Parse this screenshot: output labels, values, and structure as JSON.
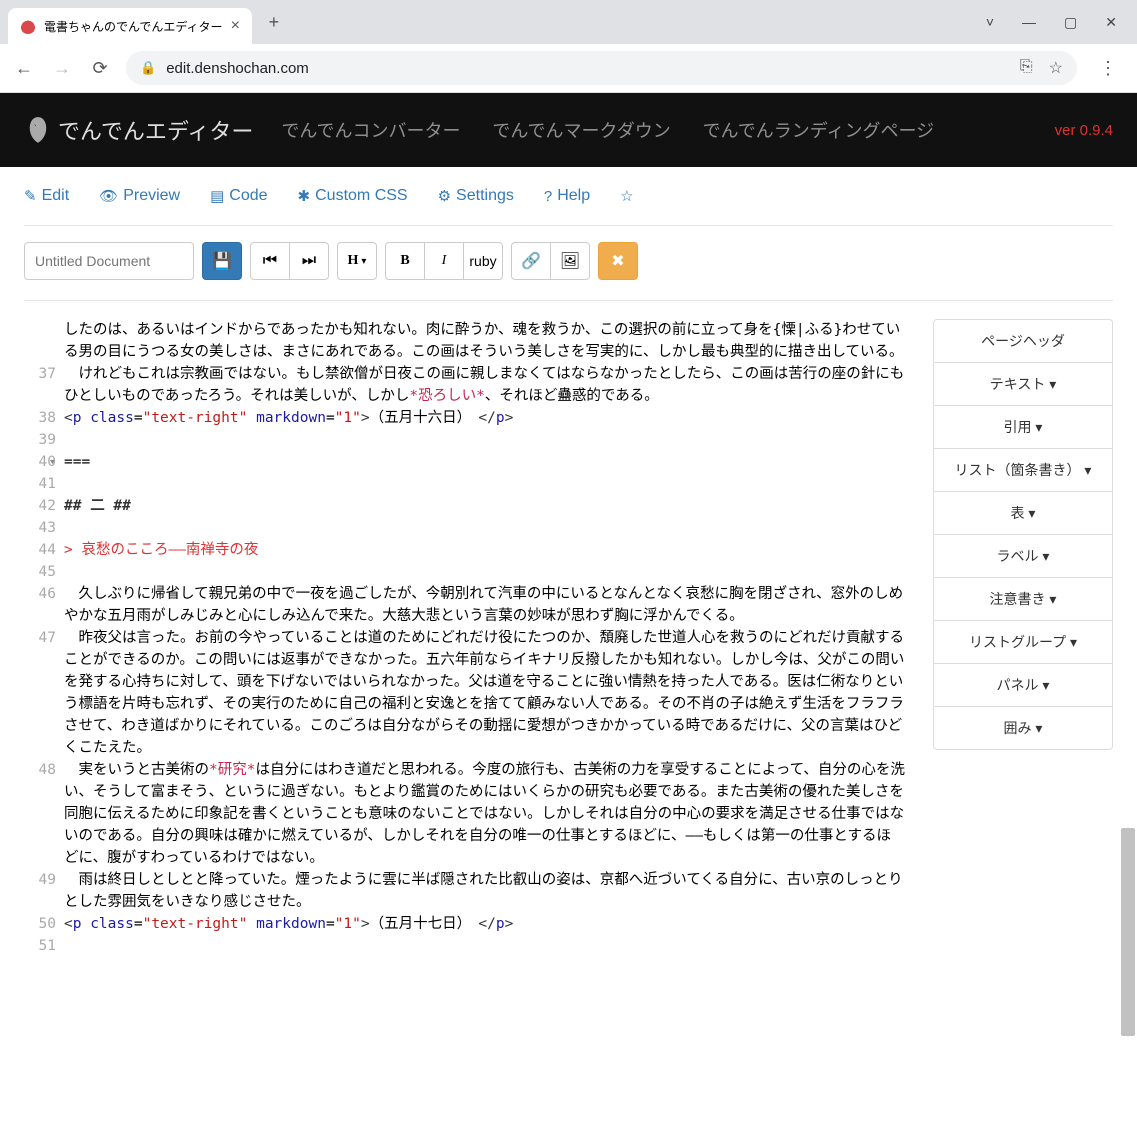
{
  "browser": {
    "tab_title": "電書ちゃんのでんでんエディター",
    "url": "edit.denshochan.com"
  },
  "header": {
    "brand": "でんでんエディター",
    "nav": [
      "でんでんコンバーター",
      "でんでんマークダウン",
      "でんでんランディングページ"
    ],
    "version": "ver 0.9.4"
  },
  "tabs": {
    "edit": "Edit",
    "preview": "Preview",
    "code": "Code",
    "css": "Custom CSS",
    "settings": "Settings",
    "help": "Help"
  },
  "title_placeholder": "Untitled Document",
  "btn_labels": {
    "heading": "H",
    "bold": "B",
    "italic": "I",
    "ruby": "ruby"
  },
  "sidebar": {
    "items": [
      "ページヘッダ",
      "テキスト ▾",
      "引用 ▾",
      "リスト（箇条書き） ▾",
      "表 ▾",
      "ラベル ▾",
      "注意書き ▾",
      "リストグループ ▾",
      "パネル ▾",
      "囲み ▾"
    ]
  },
  "editor": {
    "lines": [
      {
        "n": "",
        "text": "したのは、あるいはインドからであったかも知れない。肉に酔うか、魂を救うか、この選択の前に立って身を{慄|ふる}わせている男の目にうつる女の美しさは、まさにあれである。この画はそういう美しさを写実的に、しかし最も典型的に描き出している。"
      },
      {
        "n": "37",
        "text": "　けれどもこれは宗教画ではない。もし禁欲僧が日夜この画に親しまなくてはならなかったとしたら、この画は苦行の座の針にもひとしいものであったろう。それは美しいが、しかし",
        "em": "*恐ろしい*",
        "tail": "、それほど蠱惑的である。"
      },
      {
        "n": "38",
        "type": "ptag",
        "inner": "（五月十六日）　"
      },
      {
        "n": "39",
        "text": ""
      },
      {
        "n": "40",
        "fold": true,
        "text": "==="
      },
      {
        "n": "41",
        "text": ""
      },
      {
        "n": "42",
        "type": "head",
        "text": "## 二 ##"
      },
      {
        "n": "43",
        "text": ""
      },
      {
        "n": "44",
        "type": "quote",
        "text": "> 哀愁のこころ——南禅寺の夜"
      },
      {
        "n": "45",
        "text": ""
      },
      {
        "n": "46",
        "text": "　久しぶりに帰省して親兄弟の中で一夜を過ごしたが、今朝別れて汽車の中にいるとなんとなく哀愁に胸を閉ざされ、窓外のしめやかな五月雨がしみじみと心にしみ込んで来た。大慈大悲という言葉の妙味が思わず胸に浮かんでくる。"
      },
      {
        "n": "47",
        "text": "　昨夜父は言った。お前の今やっていることは道のためにどれだけ役にたつのか、頽廃した世道人心を救うのにどれだけ貢献することができるのか。この問いには返事ができなかった。五六年前ならイキナリ反撥したかも知れない。しかし今は、父がこの問いを発する心持ちに対して、頭を下げないではいられなかった。父は道を守ることに強い情熱を持った人である。医は仁術なりという標語を片時も忘れず、その実行のために自己の福利と安逸とを捨てて顧みない人である。その不肖の子は絶えず生活をフラフラさせて、わき道ばかりにそれている。このごろは自分ながらその動揺に愛想がつきかかっている時であるだけに、父の言葉はひどくこたえた。"
      },
      {
        "n": "48",
        "text": "　実をいうと古美術の",
        "em": "*研究*",
        "tail": "は自分にはわき道だと思われる。今度の旅行も、古美術の力を享受することによって、自分の心を洗い、そうして富まそう、というに過ぎない。もとより鑑賞のためにはいくらかの研究も必要である。また古美術の優れた美しさを同胞に伝えるために印象記を書くということも意味のないことではない。しかしそれは自分の中心の要求を満足させる仕事ではないのである。自分の興味は確かに燃えているが、しかしそれを自分の唯一の仕事とするほどに、——もしくは第一の仕事とするほどに、腹がすわっているわけではない。"
      },
      {
        "n": "49",
        "text": "　雨は終日しとしとと降っていた。煙ったように雲に半ば隠された比叡山の姿は、京都へ近づいてくる自分に、古い京のしっとりとした雰囲気をいきなり感じさせた。"
      },
      {
        "n": "50",
        "type": "ptag",
        "inner": "（五月十七日）　"
      },
      {
        "n": "51",
        "text": ""
      }
    ]
  }
}
